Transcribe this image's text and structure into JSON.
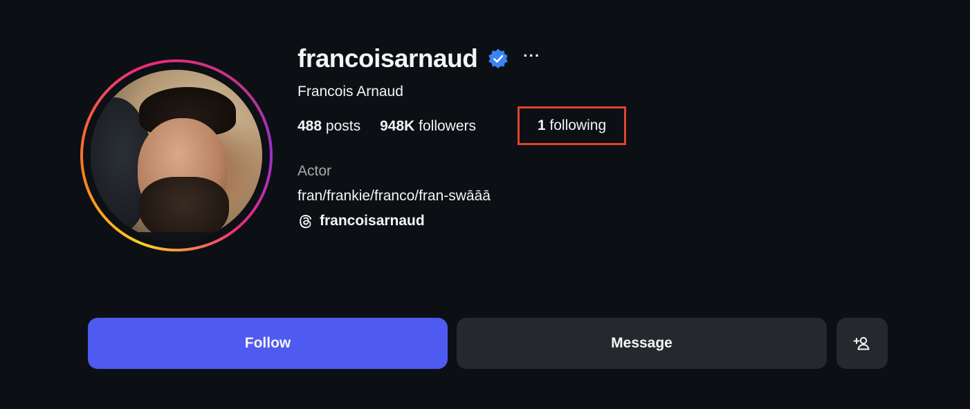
{
  "profile": {
    "username": "francoisarnaud",
    "full_name": "Francois Arnaud",
    "verified": true,
    "more_label": "···",
    "stats": {
      "posts_count": "488",
      "posts_label": "posts",
      "followers_count": "948K",
      "followers_label": "followers",
      "following_count": "1",
      "following_label": "following"
    },
    "category": "Actor",
    "bio": "fran/frankie/franco/fran-swāāā",
    "threads_handle": "francoisarnaud"
  },
  "actions": {
    "follow_label": "Follow",
    "message_label": "Message",
    "suggest_icon": "add-person-icon"
  },
  "colors": {
    "background": "#0c1014",
    "follow_button": "#4f5bf0",
    "secondary_button": "#25292e",
    "verified_badge": "#3b82f6",
    "highlight_box": "#e1432b",
    "muted_text": "#a8a8a8"
  }
}
